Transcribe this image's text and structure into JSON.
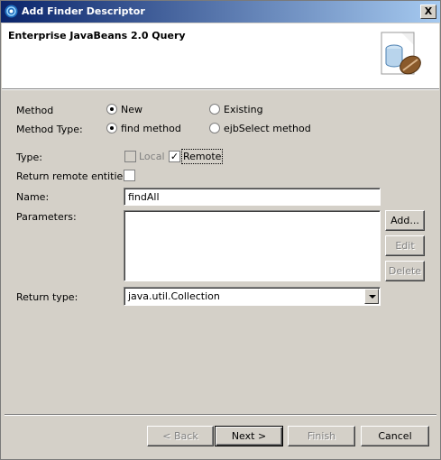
{
  "window": {
    "title": "Add Finder Descriptor",
    "close_label": "X"
  },
  "banner": {
    "title": "Enterprise JavaBeans 2.0 Query",
    "icon": "ejb-coffee-bean-icon"
  },
  "form": {
    "method": {
      "label": "Method",
      "options": [
        {
          "label": "New",
          "selected": true
        },
        {
          "label": "Existing",
          "selected": false
        }
      ]
    },
    "method_type": {
      "label": "Method Type:",
      "options": [
        {
          "label": "find method",
          "selected": true
        },
        {
          "label": "ejbSelect method",
          "selected": false
        }
      ]
    },
    "type": {
      "label": "Type:",
      "local": {
        "label": "Local",
        "checked": false,
        "enabled": false
      },
      "remote": {
        "label": "Remote",
        "checked": true,
        "enabled": true
      }
    },
    "return_remote": {
      "label": "Return remote entities:",
      "checked": false
    },
    "name": {
      "label": "Name:",
      "value": "findAll"
    },
    "parameters": {
      "label": "Parameters:",
      "add": "Add...",
      "edit": "Edit",
      "delete": "Delete"
    },
    "return_type": {
      "label": "Return type:",
      "value": "java.util.Collection"
    }
  },
  "buttons": {
    "back": "< Back",
    "next": "Next >",
    "finish": "Finish",
    "cancel": "Cancel"
  }
}
